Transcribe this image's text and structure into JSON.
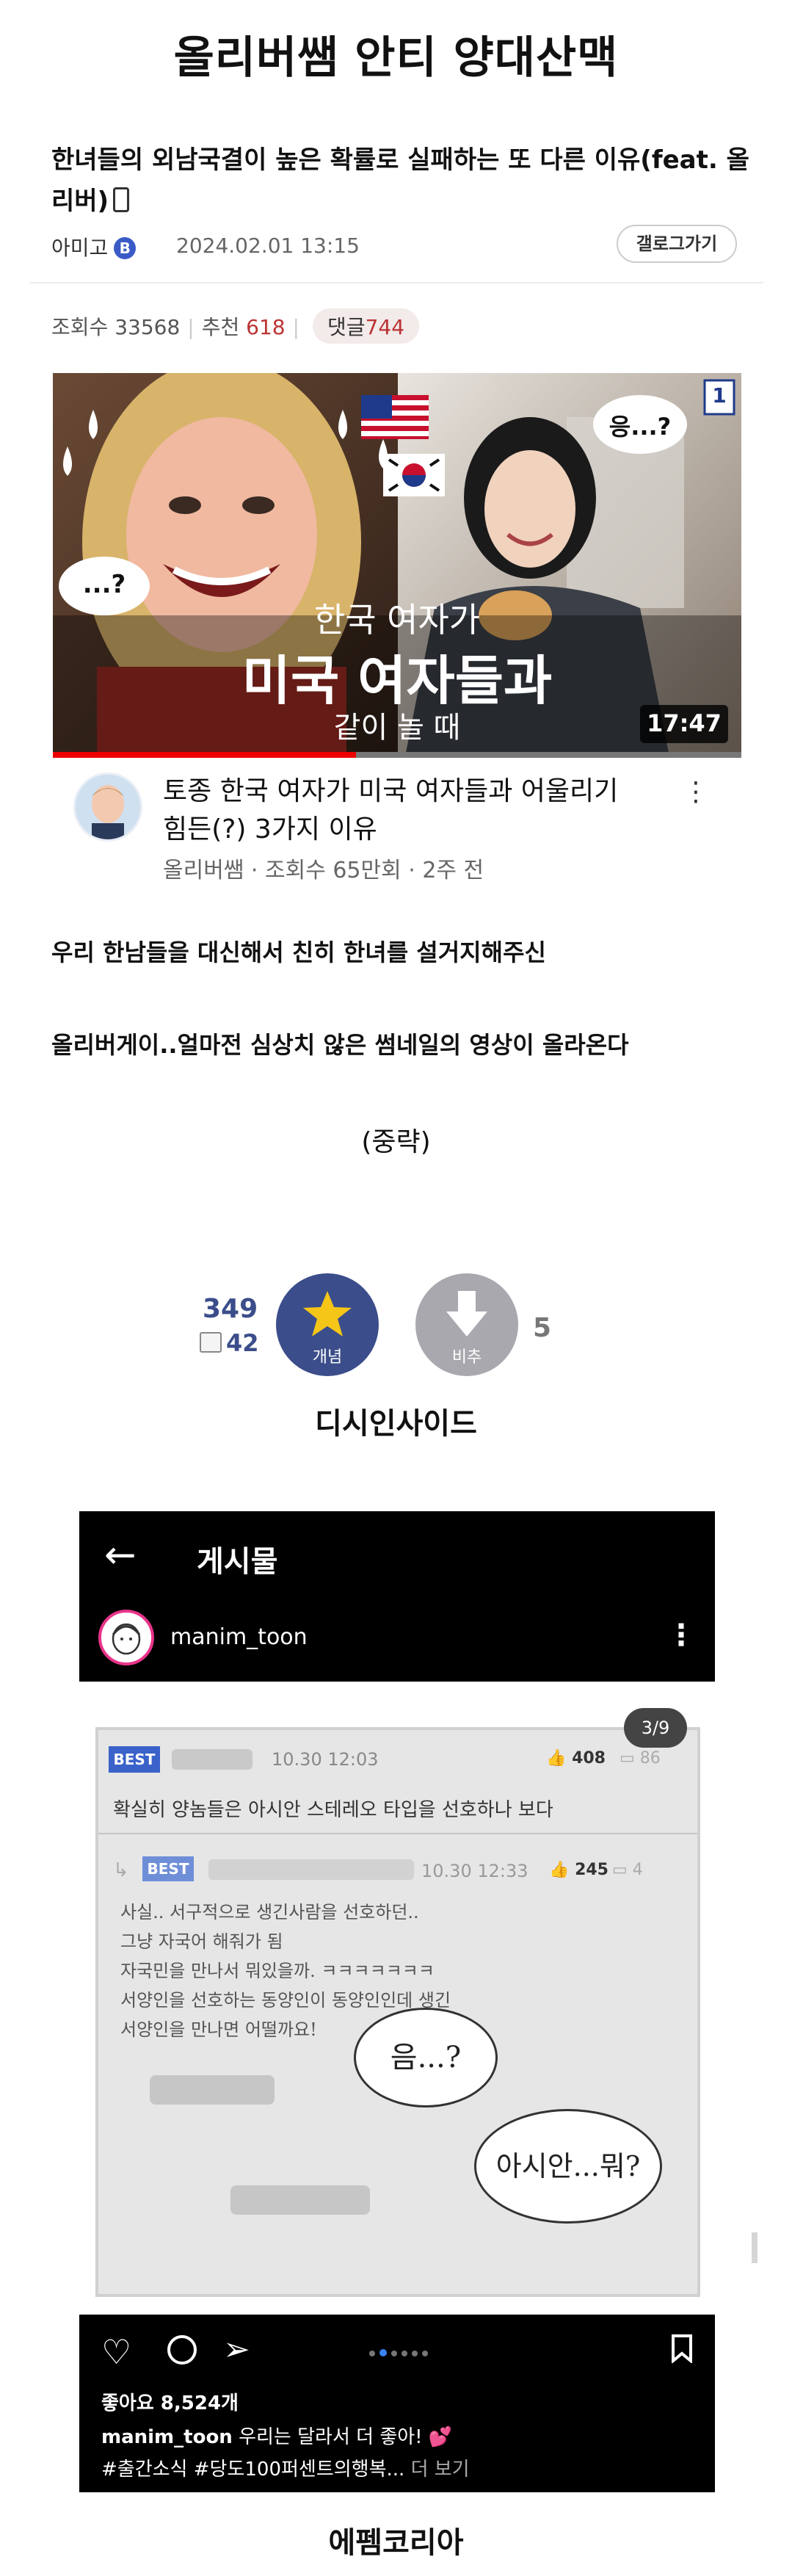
{
  "page_title": "올리버쌤 안티 양대산맥",
  "post": {
    "title": "한녀들의 외남국결이 높은 확률로 실패하는 또 다른 이유(feat. 올리버)",
    "author": "아미고",
    "author_badge": "B",
    "date": "2024.02.01 13:15",
    "gallery_button": "갤로그가기",
    "views_label": "조회수",
    "views": "33568",
    "recommend_label": "추천",
    "recommend": "618",
    "comment_label": "댓글",
    "comments": "744"
  },
  "video": {
    "badge_number": "1",
    "speech_left": "...?",
    "speech_right": "응...?",
    "overlay_line1": "한국 여자가",
    "overlay_line2": "미국 여자들과",
    "overlay_line3": "같이 놀 때",
    "duration": "17:47",
    "title": "토종 한국 여자가 미국 여자들과 어울리기 힘든(?) 3가지 이유",
    "meta": "올리버쌤 · 조회수 65만회 · 2주 전",
    "progress": 0.44
  },
  "body": {
    "line1": "우리 한남들을 대신해서 친히 한녀를 설거지해주신",
    "line2": "올리버게이..얼마전 심상치 않은 썸네일의 영상이 올라온다",
    "omitted": "(중략)"
  },
  "votes": {
    "up_count": "349",
    "fixed_count": "42",
    "up_label": "개념",
    "down_label": "비추",
    "down_count": "5"
  },
  "caption1": "디시인사이드",
  "instagram": {
    "header_title": "게시물",
    "username": "manim_toon",
    "page_indicator": "3/9",
    "best_label": "BEST",
    "post1_date": "10.30 12:03",
    "post1_likes": "408",
    "post1_comments": "86",
    "post1_text": "확실히 양놈들은 아시안 스테레오 타입을 선호하나 보다",
    "post2_date": "10.30 12:33",
    "post2_likes": "245",
    "post2_comments": "4",
    "post2_lines": [
      "사실.. 서구적으로 생긴사람을 선호하던..",
      "그냥 자국어 해줘가 됨",
      "자국민을 만나서 뭐있을까. ㅋㅋㅋㅋㅋㅋㅋ",
      "서양인을 선호하는 동양인이 동양인인데 생긴",
      "서양인을 만나면 어떨까요!"
    ],
    "bubble1": "음...?",
    "bubble2": "아시안...뭐?",
    "likes": "좋아요 8,524개",
    "caption_user": "manim_toon",
    "caption_text": "우리는 달라서 더 좋아! 💕",
    "hashtags": "#출간소식 #당도100퍼센트의행복...",
    "more": "더 보기",
    "heart_color": "#e8348a"
  },
  "caption2": "에펨코리아",
  "colors": {
    "vote_up": "#3b4d8a",
    "vote_down": "#a8a8ae",
    "star": "#f5c518",
    "red_stat": "#b33333"
  }
}
